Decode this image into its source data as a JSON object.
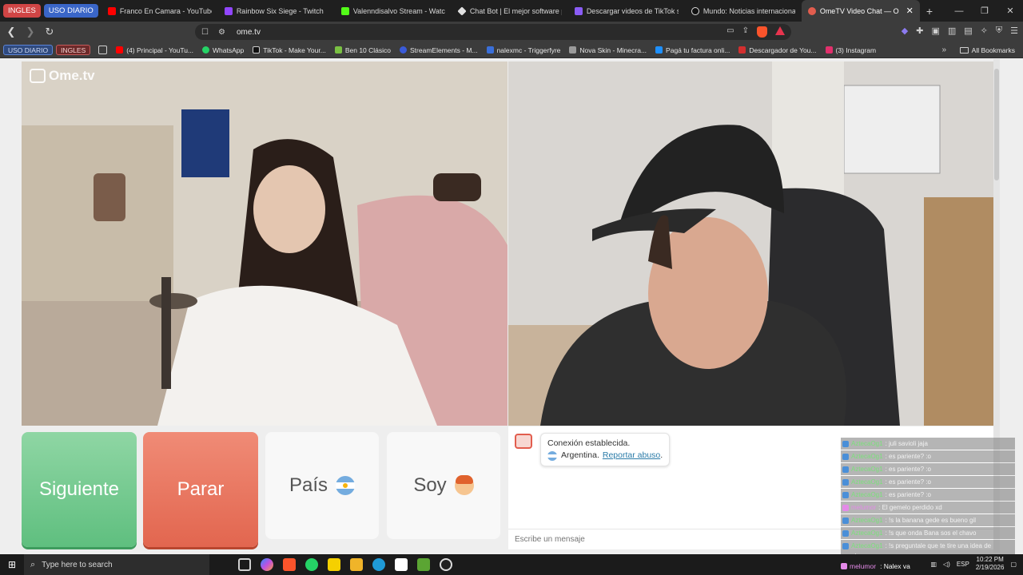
{
  "browser": {
    "tab_groups": [
      "INGLES",
      "USO DIARIO"
    ],
    "tabs": [
      {
        "title": "Franco En Camara - YouTube",
        "color": "#ff0000"
      },
      {
        "title": "Rainbow Six Siege - Twitch",
        "color": "#9146ff"
      },
      {
        "title": "Valenndisalvo Stream - Watch L",
        "color": "#53fc18"
      },
      {
        "title": "Chat Bot | El mejor software pa",
        "color": "#ffffff"
      },
      {
        "title": "Descargar videos de TikTok sin",
        "color": "#8a5cf5"
      },
      {
        "title": "Mundo: Noticias internacionales",
        "color": "#ffffff"
      },
      {
        "title": "OmeTV Video Chat — O",
        "color": "#e25d4e"
      }
    ],
    "url": "ome.tv"
  },
  "bookmarks": {
    "groups": [
      "USO DIARIO",
      "INGLES"
    ],
    "items": [
      {
        "label": "(4) Principal - YouTu...",
        "color": "#ff0000"
      },
      {
        "label": "WhatsApp",
        "color": "#25d366"
      },
      {
        "label": "TikTok - Make Your...",
        "color": "#ffffff"
      },
      {
        "label": "Ben 10 Clásico",
        "color": "#7ac143"
      },
      {
        "label": "StreamElements - M...",
        "color": "#3a5bd9"
      },
      {
        "label": "nalexmc - Triggerfyre",
        "color": "#3a6fd9"
      },
      {
        "label": "Nova Skin - Minecra...",
        "color": "#9b9b9b"
      },
      {
        "label": "Pagá tu factura onli...",
        "color": "#1e90ff"
      },
      {
        "label": "Descargador de You...",
        "color": "#d32f2f"
      },
      {
        "label": "(3) Instagram",
        "color": "#e1306c"
      }
    ],
    "all_bookmarks": "All Bookmarks"
  },
  "site": {
    "logo": "Ome.tv",
    "buttons": {
      "next": "Siguiente",
      "stop": "Parar",
      "country": "País",
      "me": "Soy"
    },
    "chat": {
      "status": "Conexión establecida.",
      "country": "Argentina.",
      "report": "Reportar abuso",
      "input_placeholder": "Escribe un mensaje"
    }
  },
  "stream_chat": [
    {
      "user": "AztecaOg1",
      "text": ": juli savioli jaja"
    },
    {
      "user": "AztecaOg1",
      "text": ": es pariente? :o"
    },
    {
      "user": "AztecaOg1",
      "text": ": es pariente? :o"
    },
    {
      "user": "AztecaOg1",
      "text": ": es pariente? :o"
    },
    {
      "user": "AztecaOg1",
      "text": ": es pariente? :o"
    },
    {
      "user": "melumor",
      "text": ": El gemelo perdido xd"
    },
    {
      "user": "AztecaOg1",
      "text": ": !s la banana gede es bueno gil"
    },
    {
      "user": "AztecaOg1",
      "text": ": !s que onda Bana sos el chavo"
    },
    {
      "user": "AztecaOg1",
      "text": ": !s preguntale que te tire una idea de"
    }
  ],
  "stream_chat_wrap": "nombre",
  "stream_chat_last": {
    "user": "melumor",
    "text": ": Nalex va"
  },
  "taskbar": {
    "search_placeholder": "Type here to search",
    "lang": "ESP",
    "time": "10:22 PM",
    "date": "2/19/2026"
  }
}
